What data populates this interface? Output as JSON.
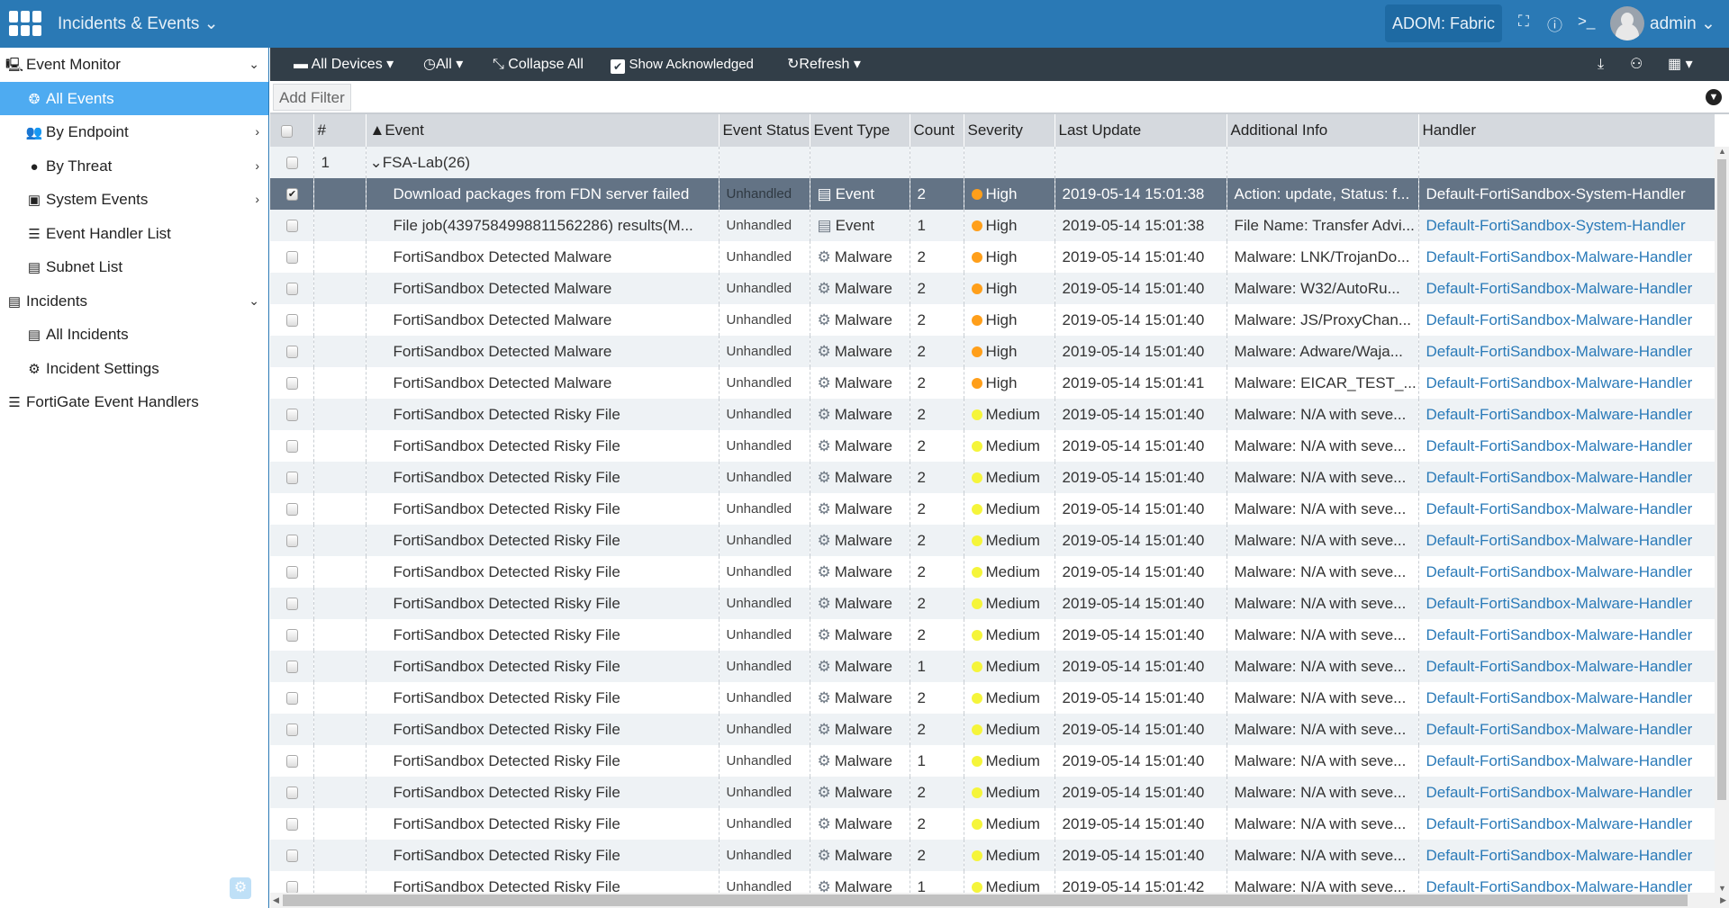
{
  "header": {
    "app_title": "Incidents & Events",
    "adom": "ADOM: Fabric",
    "user": "admin"
  },
  "sidebar": {
    "items": [
      {
        "label": "Event Monitor",
        "icon": "monitor-user-icon",
        "level": 1,
        "chevron": "down"
      },
      {
        "label": "All Events",
        "icon": "all-events-icon",
        "level": 2,
        "active": true
      },
      {
        "label": "By Endpoint",
        "icon": "users-icon",
        "level": 2,
        "chevron": "right"
      },
      {
        "label": "By Threat",
        "icon": "bomb-icon",
        "level": 2,
        "chevron": "right"
      },
      {
        "label": "System Events",
        "icon": "calendar-icon",
        "level": 2,
        "chevron": "right"
      },
      {
        "label": "Event Handler List",
        "icon": "list-icon",
        "level": 2
      },
      {
        "label": "Subnet List",
        "icon": "book-icon",
        "level": 2
      },
      {
        "label": "Incidents",
        "icon": "incidents-icon",
        "level": 1,
        "chevron": "down"
      },
      {
        "label": "All Incidents",
        "icon": "incidents-icon",
        "level": 2
      },
      {
        "label": "Incident Settings",
        "icon": "settings-icon",
        "level": 2
      },
      {
        "label": "FortiGate Event Handlers",
        "icon": "list-icon",
        "level": 1
      }
    ]
  },
  "toolbar": {
    "all_devices": "All Devices",
    "time": "All",
    "collapse": "Collapse All",
    "show_ack": "Show Acknowledged",
    "refresh": "Refresh"
  },
  "filter": {
    "add_filter": "Add Filter"
  },
  "table": {
    "columns": [
      "#",
      "Event",
      "Event Status",
      "Event Type",
      "Count",
      "Severity",
      "Last Update",
      "Additional Info",
      "Handler"
    ],
    "sort_indicator": "▲",
    "group": {
      "number": "1",
      "label": "FSA-Lab(26)"
    },
    "severity_colors": {
      "High": "#ff9f1a",
      "Medium": "#f5f53a"
    },
    "rows": [
      {
        "event": "Download packages from FDN server failed",
        "status": "Unhandled",
        "type": "Event",
        "count": "2",
        "severity": "High",
        "last_update": "2019-05-14 15:01:38",
        "info": "Action: update, Status: f...",
        "handler": "Default-FortiSandbox-System-Handler",
        "selected": true
      },
      {
        "event": "File job(4397584998811562286) results(M...",
        "status": "Unhandled",
        "type": "Event",
        "count": "1",
        "severity": "High",
        "last_update": "2019-05-14 15:01:38",
        "info": "File Name: Transfer Advi...",
        "handler": "Default-FortiSandbox-System-Handler"
      },
      {
        "event": "FortiSandbox Detected Malware",
        "status": "Unhandled",
        "type": "Malware",
        "count": "2",
        "severity": "High",
        "last_update": "2019-05-14 15:01:40",
        "info": "Malware: LNK/TrojanDo...",
        "handler": "Default-FortiSandbox-Malware-Handler"
      },
      {
        "event": "FortiSandbox Detected Malware",
        "status": "Unhandled",
        "type": "Malware",
        "count": "2",
        "severity": "High",
        "last_update": "2019-05-14 15:01:40",
        "info": "Malware: W32/AutoRu...",
        "handler": "Default-FortiSandbox-Malware-Handler"
      },
      {
        "event": "FortiSandbox Detected Malware",
        "status": "Unhandled",
        "type": "Malware",
        "count": "2",
        "severity": "High",
        "last_update": "2019-05-14 15:01:40",
        "info": "Malware: JS/ProxyChan...",
        "handler": "Default-FortiSandbox-Malware-Handler"
      },
      {
        "event": "FortiSandbox Detected Malware",
        "status": "Unhandled",
        "type": "Malware",
        "count": "2",
        "severity": "High",
        "last_update": "2019-05-14 15:01:40",
        "info": "Malware: Adware/Waja...",
        "handler": "Default-FortiSandbox-Malware-Handler"
      },
      {
        "event": "FortiSandbox Detected Malware",
        "status": "Unhandled",
        "type": "Malware",
        "count": "2",
        "severity": "High",
        "last_update": "2019-05-14 15:01:41",
        "info": "Malware: EICAR_TEST_...",
        "handler": "Default-FortiSandbox-Malware-Handler"
      },
      {
        "event": "FortiSandbox Detected Risky File",
        "status": "Unhandled",
        "type": "Malware",
        "count": "2",
        "severity": "Medium",
        "last_update": "2019-05-14 15:01:40",
        "info": "Malware: N/A with seve...",
        "handler": "Default-FortiSandbox-Malware-Handler"
      },
      {
        "event": "FortiSandbox Detected Risky File",
        "status": "Unhandled",
        "type": "Malware",
        "count": "2",
        "severity": "Medium",
        "last_update": "2019-05-14 15:01:40",
        "info": "Malware: N/A with seve...",
        "handler": "Default-FortiSandbox-Malware-Handler"
      },
      {
        "event": "FortiSandbox Detected Risky File",
        "status": "Unhandled",
        "type": "Malware",
        "count": "2",
        "severity": "Medium",
        "last_update": "2019-05-14 15:01:40",
        "info": "Malware: N/A with seve...",
        "handler": "Default-FortiSandbox-Malware-Handler"
      },
      {
        "event": "FortiSandbox Detected Risky File",
        "status": "Unhandled",
        "type": "Malware",
        "count": "2",
        "severity": "Medium",
        "last_update": "2019-05-14 15:01:40",
        "info": "Malware: N/A with seve...",
        "handler": "Default-FortiSandbox-Malware-Handler"
      },
      {
        "event": "FortiSandbox Detected Risky File",
        "status": "Unhandled",
        "type": "Malware",
        "count": "2",
        "severity": "Medium",
        "last_update": "2019-05-14 15:01:40",
        "info": "Malware: N/A with seve...",
        "handler": "Default-FortiSandbox-Malware-Handler"
      },
      {
        "event": "FortiSandbox Detected Risky File",
        "status": "Unhandled",
        "type": "Malware",
        "count": "2",
        "severity": "Medium",
        "last_update": "2019-05-14 15:01:40",
        "info": "Malware: N/A with seve...",
        "handler": "Default-FortiSandbox-Malware-Handler"
      },
      {
        "event": "FortiSandbox Detected Risky File",
        "status": "Unhandled",
        "type": "Malware",
        "count": "2",
        "severity": "Medium",
        "last_update": "2019-05-14 15:01:40",
        "info": "Malware: N/A with seve...",
        "handler": "Default-FortiSandbox-Malware-Handler"
      },
      {
        "event": "FortiSandbox Detected Risky File",
        "status": "Unhandled",
        "type": "Malware",
        "count": "2",
        "severity": "Medium",
        "last_update": "2019-05-14 15:01:40",
        "info": "Malware: N/A with seve...",
        "handler": "Default-FortiSandbox-Malware-Handler"
      },
      {
        "event": "FortiSandbox Detected Risky File",
        "status": "Unhandled",
        "type": "Malware",
        "count": "1",
        "severity": "Medium",
        "last_update": "2019-05-14 15:01:40",
        "info": "Malware: N/A with seve...",
        "handler": "Default-FortiSandbox-Malware-Handler"
      },
      {
        "event": "FortiSandbox Detected Risky File",
        "status": "Unhandled",
        "type": "Malware",
        "count": "2",
        "severity": "Medium",
        "last_update": "2019-05-14 15:01:40",
        "info": "Malware: N/A with seve...",
        "handler": "Default-FortiSandbox-Malware-Handler"
      },
      {
        "event": "FortiSandbox Detected Risky File",
        "status": "Unhandled",
        "type": "Malware",
        "count": "2",
        "severity": "Medium",
        "last_update": "2019-05-14 15:01:40",
        "info": "Malware: N/A with seve...",
        "handler": "Default-FortiSandbox-Malware-Handler"
      },
      {
        "event": "FortiSandbox Detected Risky File",
        "status": "Unhandled",
        "type": "Malware",
        "count": "1",
        "severity": "Medium",
        "last_update": "2019-05-14 15:01:40",
        "info": "Malware: N/A with seve...",
        "handler": "Default-FortiSandbox-Malware-Handler"
      },
      {
        "event": "FortiSandbox Detected Risky File",
        "status": "Unhandled",
        "type": "Malware",
        "count": "2",
        "severity": "Medium",
        "last_update": "2019-05-14 15:01:40",
        "info": "Malware: N/A with seve...",
        "handler": "Default-FortiSandbox-Malware-Handler"
      },
      {
        "event": "FortiSandbox Detected Risky File",
        "status": "Unhandled",
        "type": "Malware",
        "count": "2",
        "severity": "Medium",
        "last_update": "2019-05-14 15:01:40",
        "info": "Malware: N/A with seve...",
        "handler": "Default-FortiSandbox-Malware-Handler"
      },
      {
        "event": "FortiSandbox Detected Risky File",
        "status": "Unhandled",
        "type": "Malware",
        "count": "2",
        "severity": "Medium",
        "last_update": "2019-05-14 15:01:40",
        "info": "Malware: N/A with seve...",
        "handler": "Default-FortiSandbox-Malware-Handler"
      },
      {
        "event": "FortiSandbox Detected Risky File",
        "status": "Unhandled",
        "type": "Malware",
        "count": "1",
        "severity": "Medium",
        "last_update": "2019-05-14 15:01:42",
        "info": "Malware: N/A with seve...",
        "handler": "Default-FortiSandbox-Malware-Handler"
      }
    ]
  }
}
